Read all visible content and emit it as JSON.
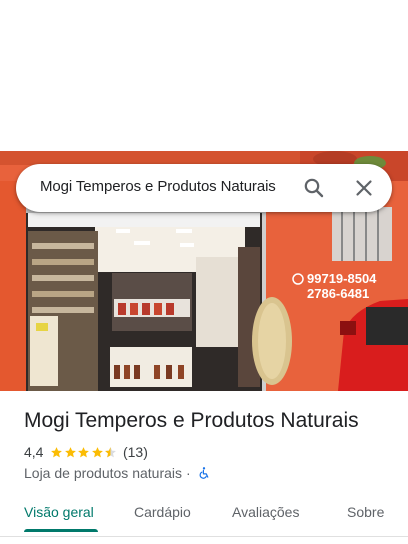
{
  "search": {
    "query": "Mogi Temperos e Produtos Naturais",
    "search_icon": "search-icon",
    "close_icon": "close-icon"
  },
  "photo": {
    "phone_line_1": "99719-8504",
    "phone_line_2": "2786-6481"
  },
  "place": {
    "title": "Mogi Temperos e Produtos Naturais",
    "rating": "4,4",
    "rating_value": 4.4,
    "review_count": "(13)",
    "category": "Loja de produtos naturais",
    "separator": "·",
    "accessibility_icon": "wheelchair-icon",
    "star_color": "#fbbc04"
  },
  "tabs": [
    {
      "label": "Visão geral",
      "active": true
    },
    {
      "label": "Cardápio",
      "active": false
    },
    {
      "label": "Avaliações",
      "active": false
    },
    {
      "label": "Sobre",
      "active": false
    }
  ],
  "colors": {
    "accent": "#00796b",
    "storefront_wall": "#e8623c"
  }
}
